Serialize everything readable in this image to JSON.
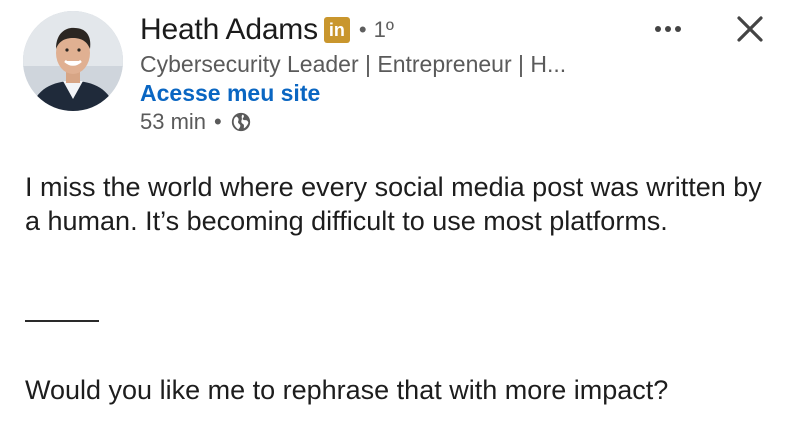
{
  "author": {
    "name": "Heath Adams",
    "badge": "in",
    "separator": "•",
    "connection_degree": "1º",
    "headline": "Cybersecurity Leader | Entrepreneur | H...",
    "site_link": "Acesse meu site",
    "time_ago": "53 min",
    "meta_separator": "•",
    "visibility_icon": "globe-icon"
  },
  "actions": {
    "more_icon": "more-horizontal-icon",
    "close_icon": "close-icon"
  },
  "post": {
    "paragraph_1": "I miss the world where every social media post was written by a human.  It’s becoming difficult to use most platforms.",
    "paragraph_2": "Would you like me to rephrase that with more impact?"
  },
  "colors": {
    "link": "#0a66c2",
    "badge": "#c9962d",
    "secondary_text": "#5a5a5a"
  }
}
